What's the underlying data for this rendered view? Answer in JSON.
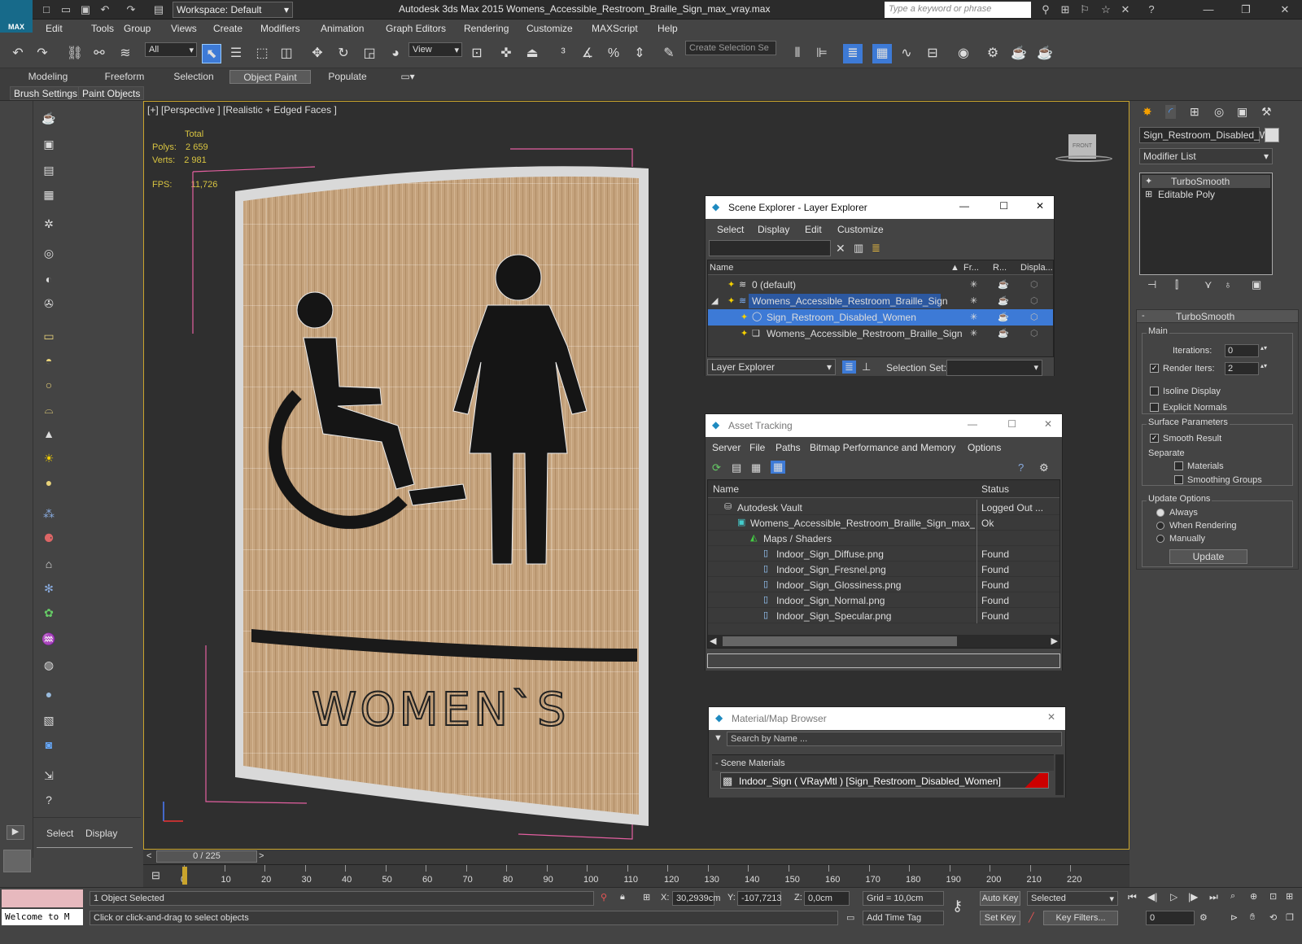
{
  "app": {
    "logo_text": "MAX",
    "workspace": "Workspace: Default",
    "title": "Autodesk 3ds Max  2015    Womens_Accessible_Restroom_Braille_Sign_max_vray.max",
    "search_placeholder": "Type a keyword or phrase"
  },
  "menu": [
    "Edit",
    "Tools",
    "Group",
    "Views",
    "Create",
    "Modifiers",
    "Animation",
    "Graph Editors",
    "Rendering",
    "Customize",
    "MAXScript",
    "Help"
  ],
  "toolbar": {
    "selection_filter": "All",
    "ref_coord": "View",
    "selection_set": "Create Selection Se"
  },
  "ribbon": {
    "tabs": [
      "Modeling",
      "Freeform",
      "Selection",
      "Object Paint",
      "Populate"
    ],
    "active": "Object Paint",
    "sub": [
      "Brush Settings",
      "Paint Objects"
    ]
  },
  "viewport": {
    "label": "[+] [Perspective ] [Realistic + Edged Faces ]",
    "stats_total": "Total",
    "polys_label": "Polys:",
    "polys": "2 659",
    "verts_label": "Verts:",
    "verts": "2 981",
    "fps_label": "FPS:",
    "fps": "11,726",
    "sign_text": "WOMEN`S",
    "viewcube": "FRONT"
  },
  "scene_explorer": {
    "title": "Scene Explorer - Layer Explorer",
    "menu": [
      "Select",
      "Display",
      "Edit",
      "Customize"
    ],
    "columns": [
      "Name",
      "Fr...",
      "R...",
      "Displa..."
    ],
    "rows": [
      {
        "name": "0 (default)"
      },
      {
        "name": "Womens_Accessible_Restroom_Braille_Sign"
      },
      {
        "name": "Sign_Restroom_Disabled_Women"
      },
      {
        "name": "Womens_Accessible_Restroom_Braille_Sign"
      }
    ],
    "footer_mode": "Layer Explorer",
    "selection_set_label": "Selection Set:"
  },
  "asset_tracking": {
    "title": "Asset Tracking",
    "menu": [
      "Server",
      "File",
      "Paths",
      "Bitmap Performance and Memory",
      "Options"
    ],
    "columns": [
      "Name",
      "Status"
    ],
    "rows": [
      {
        "name": "Autodesk Vault",
        "status": "Logged Out ..."
      },
      {
        "name": "Womens_Accessible_Restroom_Braille_Sign_max_v...",
        "status": "Ok"
      },
      {
        "name": "Maps / Shaders",
        "status": ""
      },
      {
        "name": "Indoor_Sign_Diffuse.png",
        "status": "Found"
      },
      {
        "name": "Indoor_Sign_Fresnel.png",
        "status": "Found"
      },
      {
        "name": "Indoor_Sign_Glossiness.png",
        "status": "Found"
      },
      {
        "name": "Indoor_Sign_Normal.png",
        "status": "Found"
      },
      {
        "name": "Indoor_Sign_Specular.png",
        "status": "Found"
      }
    ]
  },
  "material_browser": {
    "title": "Material/Map Browser",
    "search_placeholder": "Search by Name ...",
    "section": "- Scene Materials",
    "item": "Indoor_Sign ( VRayMtl ) [Sign_Restroom_Disabled_Women]"
  },
  "modify_panel": {
    "object_name": "Sign_Restroom_Disabled_Wo",
    "modifier_list": "Modifier List",
    "stack": [
      "TurboSmooth",
      "Editable Poly"
    ],
    "rollout_title": "TurboSmooth",
    "main_label": "Main",
    "iterations_label": "Iterations:",
    "iterations": "0",
    "render_iters_label": "Render Iters:",
    "render_iters": "2",
    "isoline": "Isoline Display",
    "explicit_normals": "Explicit Normals",
    "surface_params": "Surface Parameters",
    "smooth_result": "Smooth Result",
    "separate": "Separate",
    "materials": "Materials",
    "smoothing_groups": "Smoothing Groups",
    "update_options": "Update Options",
    "always": "Always",
    "when_rendering": "When Rendering",
    "manually": "Manually",
    "update_btn": "Update"
  },
  "cmd_tabs": [
    "Select",
    "Display"
  ],
  "timeline": {
    "frame": "0 / 225",
    "ticks": [
      "0",
      "10",
      "20",
      "30",
      "40",
      "50",
      "60",
      "70",
      "80",
      "90",
      "100",
      "110",
      "120",
      "130",
      "140",
      "150",
      "160",
      "170",
      "180",
      "190",
      "200",
      "210",
      "220"
    ]
  },
  "status": {
    "maxscript": "Welcome to M",
    "selected": "1 Object Selected",
    "prompt": "Click or click-and-drag to select objects",
    "x_label": "X:",
    "x": "30,2939cm",
    "y_label": "Y:",
    "y": "-107,7213",
    "z_label": "Z:",
    "z": "0,0cm",
    "grid": "Grid = 10,0cm",
    "auto_key": "Auto Key",
    "set_key": "Set Key",
    "key_mode": "Selected",
    "key_filters": "Key Filters...",
    "add_time_tag": "Add Time Tag",
    "frame_field": "0"
  },
  "colors": {
    "accent": "#c9a42c",
    "selection": "#3d7ad6",
    "wood": "#c9a27a"
  }
}
